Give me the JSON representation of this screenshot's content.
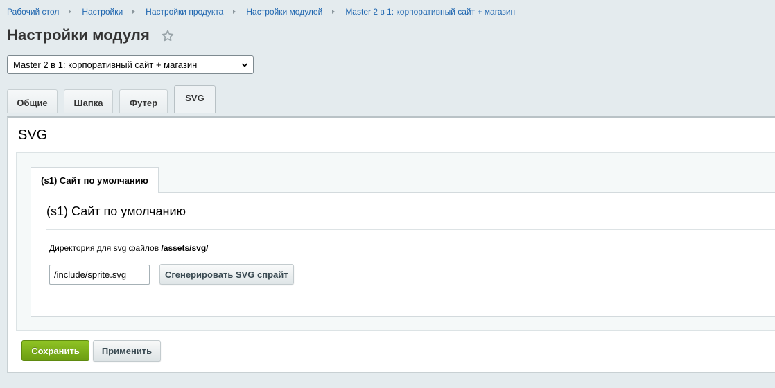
{
  "breadcrumb": {
    "items": [
      "Рабочий стол",
      "Настройки",
      "Настройки продукта",
      "Настройки модулей",
      "Master 2 в 1: корпоративный сайт + магазин"
    ]
  },
  "header": {
    "title": "Настройки модуля",
    "star_icon": "star-icon"
  },
  "module_select": {
    "selected": "Master 2 в 1: корпоративный сайт + магазин"
  },
  "tabs": [
    {
      "label": "Общие",
      "active": false
    },
    {
      "label": "Шапка",
      "active": false
    },
    {
      "label": "Футер",
      "active": false
    },
    {
      "label": "SVG",
      "active": true
    }
  ],
  "svg_section": {
    "title": "SVG",
    "site_tab": {
      "label": "(s1) Сайт по умолчанию"
    },
    "site_title": "(s1) Сайт по умолчанию",
    "directory_label": "Директория для svg файлов",
    "directory_value": "/assets/svg/",
    "sprite_input": {
      "value": "/include/sprite.svg"
    },
    "generate_button": "Сгенерировать SVG спрайт"
  },
  "actions": {
    "save_label": "Сохранить",
    "apply_label": "Применить"
  },
  "colors": {
    "link": "#2067b0",
    "background": "#e4ebee",
    "save_green": "#7cb01a"
  }
}
